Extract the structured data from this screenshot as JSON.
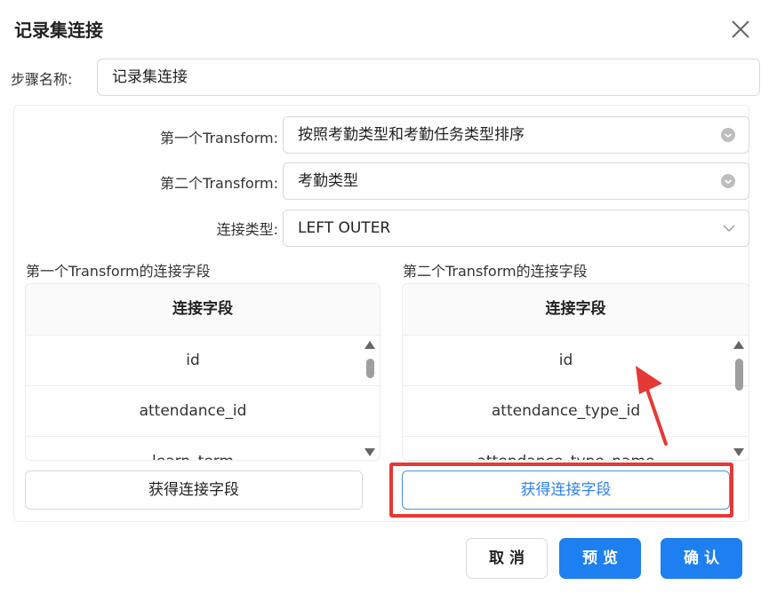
{
  "dialog": {
    "title": "记录集连接",
    "step_name_label": "步骤名称:",
    "step_name_value": "记录集连接"
  },
  "form": {
    "first_transform_label": "第一个Transform:",
    "first_transform_value": "按照考勤类型和考勤任务类型排序",
    "second_transform_label": "第二个Transform:",
    "second_transform_value": "考勤类型",
    "join_type_label": "连接类型:",
    "join_type_value": "LEFT OUTER"
  },
  "left_table": {
    "section_title": "第一个Transform的连接字段",
    "header": "连接字段",
    "rows": [
      "id",
      "attendance_id",
      "learn_term"
    ],
    "button": "获得连接字段"
  },
  "right_table": {
    "section_title": "第二个Transform的连接字段",
    "header": "连接字段",
    "rows": [
      "id",
      "attendance_type_id",
      "attendance_type_name"
    ],
    "button": "获得连接字段"
  },
  "footer": {
    "cancel": "取 消",
    "preview": "预 览",
    "ok": "确 认"
  },
  "colors": {
    "primary": "#1e7ff0",
    "highlight": "#e53935"
  },
  "icons": {
    "close": "close-icon",
    "clear": "clear-circle-icon",
    "dropdown": "chevron-down-icon",
    "scroll_up": "triangle-up-icon",
    "scroll_down": "triangle-down-icon",
    "annotation": "red-arrow-icon"
  }
}
